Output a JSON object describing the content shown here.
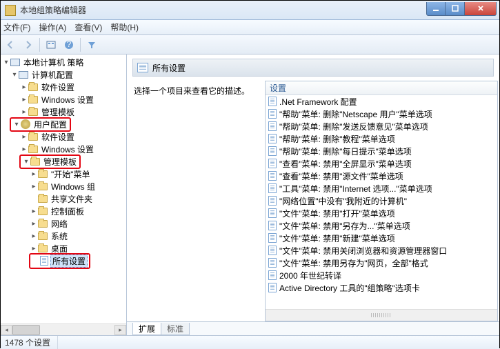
{
  "window": {
    "title": "本地组策略编辑器"
  },
  "menu": {
    "file": "文件(F)",
    "action": "操作(A)",
    "view": "查看(V)",
    "help": "帮助(H)"
  },
  "tree": {
    "root": "本地计算机 策略",
    "computer_config": "计算机配置",
    "cc_software": "软件设置",
    "cc_windows": "Windows 设置",
    "cc_admin": "管理模板",
    "user_config": "用户配置",
    "uc_software": "软件设置",
    "uc_windows": "Windows 设置",
    "uc_admin": "管理模板",
    "start_menu": "\"开始\"菜单",
    "win_components": "Windows 组",
    "shared_folders": "共享文件夹",
    "control_panel": "控制面板",
    "network": "网络",
    "system": "系统",
    "desktop": "桌面",
    "all_settings": "所有设置"
  },
  "right": {
    "header": "所有设置",
    "prompt": "选择一个项目来查看它的描述。",
    "column": "设置",
    "items": [
      ".Net Framework 配置",
      "\"帮助\"菜单: 删除\"Netscape 用户\"菜单选项",
      "\"帮助\"菜单: 删除\"发送反馈意见\"菜单选项",
      "\"帮助\"菜单: 删除\"教程\"菜单选项",
      "\"帮助\"菜单: 删除\"每日提示\"菜单选项",
      "\"查看\"菜单: 禁用\"全屏显示\"菜单选项",
      "\"查看\"菜单: 禁用\"源文件\"菜单选项",
      "\"工具\"菜单: 禁用\"Internet 选项...\"菜单选项",
      "\"网络位置\"中没有\"我附近的计算机\"",
      "\"文件\"菜单: 禁用\"打开\"菜单选项",
      "\"文件\"菜单: 禁用\"另存为...\"菜单选项",
      "\"文件\"菜单: 禁用\"新建\"菜单选项",
      "\"文件\"菜单: 禁用关闭浏览器和资源管理器窗口",
      "\"文件\"菜单: 禁用另存为\"网页，全部\"格式",
      "2000 年世纪转译",
      "Active Directory 工具的\"组策略\"选项卡"
    ],
    "tab_extended": "扩展",
    "tab_standard": "标准"
  },
  "status": {
    "count": "1478 个设置"
  }
}
